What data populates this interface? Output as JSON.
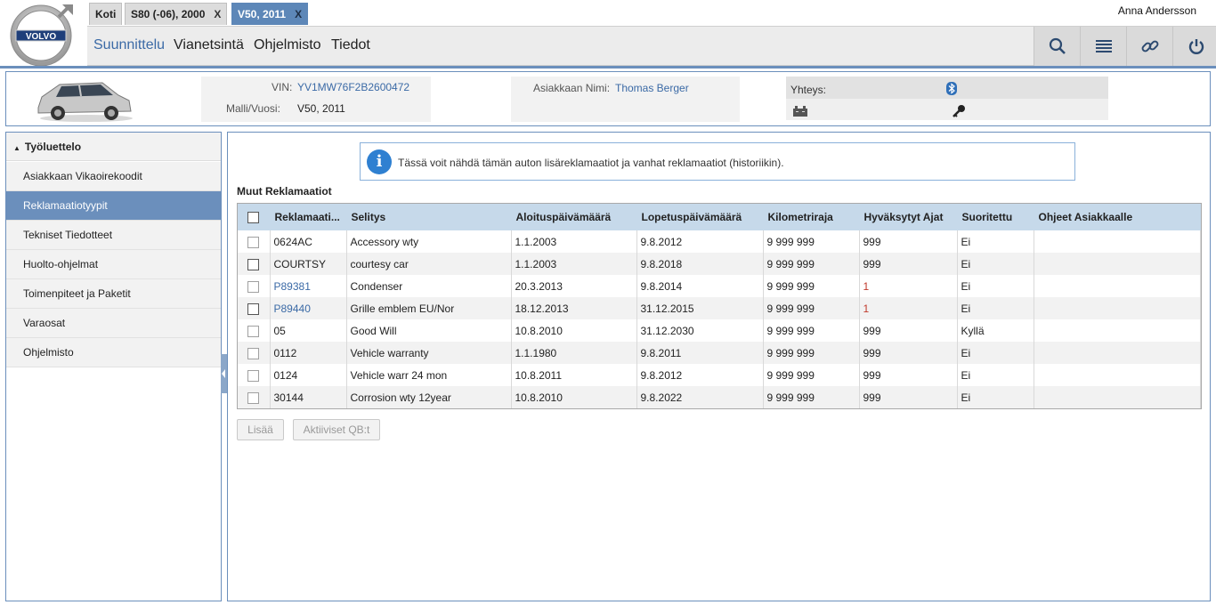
{
  "header": {
    "logo_text": "VOLVO",
    "user_name": "Anna Andersson",
    "tabs": [
      {
        "label": "Koti",
        "closable": false
      },
      {
        "label": "S80 (-06), 2000",
        "closable": true
      },
      {
        "label": "V50, 2011",
        "closable": true,
        "active": true
      }
    ],
    "close_glyph": "X",
    "nav": [
      "Suunnittelu",
      "Vianetsintä",
      "Ohjelmisto",
      "Tiedot"
    ],
    "nav_active": "Suunnittelu",
    "toolbar_icons": [
      "search-icon",
      "list-icon",
      "link-icon",
      "power-icon"
    ],
    "accent_color": "#6b8fbc"
  },
  "vehicle": {
    "vin_label": "VIN:",
    "vin": "YV1MW76F2B2600472",
    "model_label": "Malli/Vuosi:",
    "model": "V50, 2011",
    "customer_label": "Asiakkaan Nimi:",
    "customer": "Thomas Berger",
    "connection_label": "Yhteys:",
    "connection_icons": [
      "bluetooth-icon",
      "battery-icon",
      "key-icon"
    ]
  },
  "sidebar": {
    "title": "Työluettelo",
    "items": [
      {
        "label": "Asiakkaan Vikaoirekoodit"
      },
      {
        "label": "Reklamaatiotyypit",
        "active": true
      },
      {
        "label": "Tekniset Tiedotteet"
      },
      {
        "label": "Huolto-ohjelmat"
      },
      {
        "label": "Toimenpiteet ja Paketit"
      },
      {
        "label": "Varaosat"
      },
      {
        "label": "Ohjelmisto"
      }
    ]
  },
  "main": {
    "info": "Tässä voit nähdä tämän auton lisäreklamaatiot ja vanhat reklamaatiot (historiikin).",
    "section_title": "Muut Reklamaatiot",
    "columns": [
      "Reklamaati...",
      "Selitys",
      "Aloituspäivämäärä",
      "Lopetuspäivämäärä",
      "Kilometriraja",
      "Hyväksytyt Ajat",
      "Suoritettu",
      "Ohjeet Asiakkaalle"
    ],
    "rows": [
      {
        "code": "0624AC",
        "desc": "Accessory wty",
        "start": "1.1.2003",
        "end": "9.8.2012",
        "km": "9 999 999",
        "hours": "999",
        "done": "Ei",
        "notes": ""
      },
      {
        "code": "COURTSY",
        "desc": "courtesy car",
        "start": "1.1.2003",
        "end": "9.8.2018",
        "km": "9 999 999",
        "hours": "999",
        "done": "Ei",
        "notes": ""
      },
      {
        "code": "P89381",
        "desc": "Condenser",
        "start": "20.3.2013",
        "end": "9.8.2014",
        "km": "9 999 999",
        "hours": "1",
        "done": "Ei",
        "notes": "",
        "link": true
      },
      {
        "code": "P89440",
        "desc": "Grille emblem EU/Nor",
        "start": "18.12.2013",
        "end": "31.12.2015",
        "km": "9 999 999",
        "hours": "1",
        "done": "Ei",
        "notes": "",
        "link": true
      },
      {
        "code": "05",
        "desc": "Good Will",
        "start": "10.8.2010",
        "end": "31.12.2030",
        "km": "9 999 999",
        "hours": "999",
        "done": "Kyllä",
        "notes": ""
      },
      {
        "code": "0112",
        "desc": "Vehicle warranty",
        "start": "1.1.1980",
        "end": "9.8.2011",
        "km": "9 999 999",
        "hours": "999",
        "done": "Ei",
        "notes": ""
      },
      {
        "code": "0124",
        "desc": "Vehicle warr 24 mon",
        "start": "10.8.2011",
        "end": "9.8.2012",
        "km": "9 999 999",
        "hours": "999",
        "done": "Ei",
        "notes": ""
      },
      {
        "code": "30144",
        "desc": "Corrosion wty 12year",
        "start": "10.8.2010",
        "end": "9.8.2022",
        "km": "9 999 999",
        "hours": "999",
        "done": "Ei",
        "notes": ""
      }
    ],
    "buttons": {
      "add": "Lisää",
      "active_qb": "Aktiiviset QB:t"
    }
  }
}
